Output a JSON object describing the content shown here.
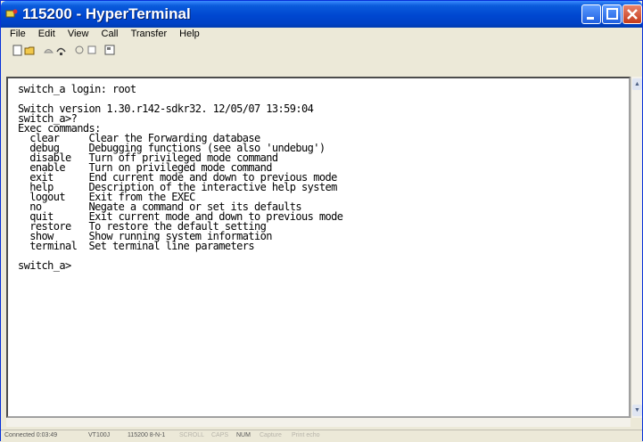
{
  "window": {
    "title": "115200 - HyperTerminal"
  },
  "menu": [
    "File",
    "Edit",
    "View",
    "Call",
    "Transfer",
    "Help"
  ],
  "toolbar": [
    "new-connection-icon",
    "open-icon",
    "dial-icon",
    "disconnect-icon",
    "send-icon",
    "receive-icon",
    "properties-icon"
  ],
  "terminal": {
    "lines": [
      "switch_a login: root",
      "",
      "Switch version 1.30.r142-sdkr32. 12/05/07 13:59:04",
      "switch_a>?",
      "Exec commands:",
      "  clear     Clear the Forwarding database",
      "  debug     Debugging functions (see also 'undebug')",
      "  disable   Turn off privileged mode command",
      "  enable    Turn on privileged mode command",
      "  exit      End current mode and down to previous mode",
      "  help      Description of the interactive help system",
      "  logout    Exit from the EXEC",
      "  no        Negate a command or set its defaults",
      "  quit      Exit current mode and down to previous mode",
      "  restore   To restore the default setting",
      "  show      Show running system information",
      "  terminal  Set terminal line parameters",
      "",
      "switch_a>"
    ]
  },
  "status": {
    "connected": "Connected 0:03:49",
    "emulation": "VT100J",
    "port": "115200 8-N-1",
    "scroll": "SCROLL",
    "caps": "CAPS",
    "num": "NUM",
    "capture": "Capture",
    "print_echo": "Print echo"
  }
}
